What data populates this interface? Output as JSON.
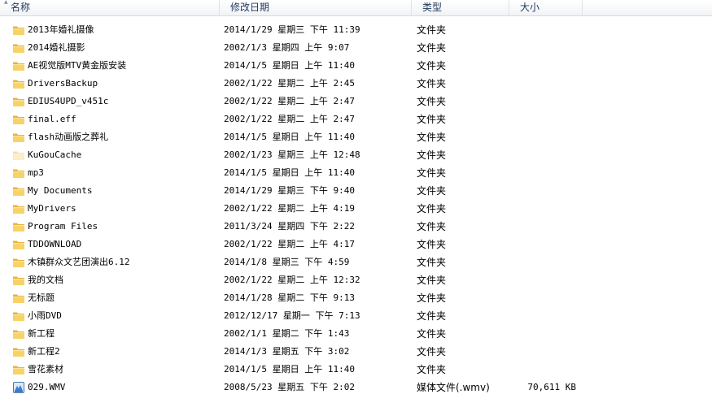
{
  "columns": {
    "name": "名称",
    "date": "修改日期",
    "type": "类型",
    "size": "大小"
  },
  "files": [
    {
      "name": "2013年婚礼摄像",
      "date": "2014/1/29 星期三 下午 11:39",
      "type": "文件夹",
      "size": "",
      "icon": "folder-icon"
    },
    {
      "name": "2014婚礼摄影",
      "date": "2002/1/3 星期四 上午 9:07",
      "type": "文件夹",
      "size": "",
      "icon": "folder-icon"
    },
    {
      "name": "AE视觉版MTV黄金版安装",
      "date": "2014/1/5 星期日 上午 11:40",
      "type": "文件夹",
      "size": "",
      "icon": "folder-icon"
    },
    {
      "name": "DriversBackup",
      "date": "2002/1/22 星期二 上午 2:45",
      "type": "文件夹",
      "size": "",
      "icon": "folder-icon"
    },
    {
      "name": "EDIUS4UPD_v451c",
      "date": "2002/1/22 星期二 上午 2:47",
      "type": "文件夹",
      "size": "",
      "icon": "folder-icon"
    },
    {
      "name": "final.eff",
      "date": "2002/1/22 星期二 上午 2:47",
      "type": "文件夹",
      "size": "",
      "icon": "folder-icon"
    },
    {
      "name": "flash动画版之葬礼",
      "date": "2014/1/5 星期日 上午 11:40",
      "type": "文件夹",
      "size": "",
      "icon": "folder-icon"
    },
    {
      "name": "KuGouCache",
      "date": "2002/1/23 星期三 上午 12:48",
      "type": "文件夹",
      "size": "",
      "icon": "hidden-folder-icon"
    },
    {
      "name": "mp3",
      "date": "2014/1/5 星期日 上午 11:40",
      "type": "文件夹",
      "size": "",
      "icon": "folder-icon"
    },
    {
      "name": "My Documents",
      "date": "2014/1/29 星期三 下午 9:40",
      "type": "文件夹",
      "size": "",
      "icon": "folder-icon"
    },
    {
      "name": "MyDrivers",
      "date": "2002/1/22 星期二 上午 4:19",
      "type": "文件夹",
      "size": "",
      "icon": "folder-icon"
    },
    {
      "name": "Program Files",
      "date": "2011/3/24 星期四 下午 2:22",
      "type": "文件夹",
      "size": "",
      "icon": "folder-icon"
    },
    {
      "name": "TDDOWNLOAD",
      "date": "2002/1/22 星期二 上午 4:17",
      "type": "文件夹",
      "size": "",
      "icon": "folder-icon"
    },
    {
      "name": "木镇群众文艺团演出6.12",
      "date": "2014/1/8 星期三 下午 4:59",
      "type": "文件夹",
      "size": "",
      "icon": "folder-icon"
    },
    {
      "name": "我的文档",
      "date": "2002/1/22 星期二 上午 12:32",
      "type": "文件夹",
      "size": "",
      "icon": "folder-icon"
    },
    {
      "name": "无标题",
      "date": "2014/1/28 星期二 下午 9:13",
      "type": "文件夹",
      "size": "",
      "icon": "folder-icon"
    },
    {
      "name": "小雨DVD",
      "date": "2012/12/17 星期一 下午 7:13",
      "type": "文件夹",
      "size": "",
      "icon": "folder-icon"
    },
    {
      "name": "新工程",
      "date": "2002/1/1 星期二 下午 1:43",
      "type": "文件夹",
      "size": "",
      "icon": "folder-icon"
    },
    {
      "name": "新工程2",
      "date": "2014/1/3 星期五 下午 3:02",
      "type": "文件夹",
      "size": "",
      "icon": "folder-icon"
    },
    {
      "name": "雪花素材",
      "date": "2014/1/5 星期日 上午 11:40",
      "type": "文件夹",
      "size": "",
      "icon": "folder-icon"
    },
    {
      "name": "029.WMV",
      "date": "2008/5/23 星期五 下午 2:02",
      "type": "媒体文件(.wmv)",
      "size": "70,611 KB",
      "icon": "media-file-icon"
    }
  ]
}
